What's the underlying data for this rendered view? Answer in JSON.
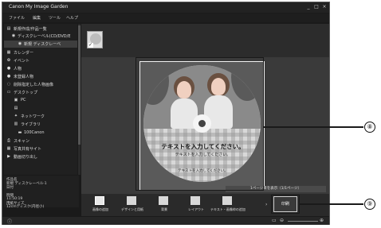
{
  "window": {
    "title": "Canon My Image Garden",
    "controls": [
      "_",
      "□",
      "×"
    ]
  },
  "menu": [
    "ファイル",
    "編集",
    "ツール",
    "ヘルプ"
  ],
  "sidebar": {
    "items": [
      {
        "label": "新規作成/作品一覧",
        "icon": "new-doc-icon",
        "glyph": "▤"
      },
      {
        "label": "ディスクレーベル(CD/DVD/E",
        "icon": "disc-icon",
        "glyph": "◉"
      },
      {
        "label": "新規 ディスクレーベ",
        "icon": "disc-icon",
        "glyph": "◉"
      },
      {
        "label": "カレンダー",
        "icon": "calendar-icon",
        "glyph": "▦"
      },
      {
        "label": "イベント",
        "icon": "event-icon",
        "glyph": "✿"
      },
      {
        "label": "人物",
        "icon": "person-icon",
        "glyph": "●"
      },
      {
        "label": "未登録人物",
        "icon": "person-icon",
        "glyph": "●"
      },
      {
        "label": "削除指定した人物画像",
        "icon": "person-delete-icon",
        "glyph": "◌"
      },
      {
        "label": "デスクトップ",
        "icon": "desktop-icon",
        "glyph": "▭"
      },
      {
        "label": "PC",
        "icon": "pc-icon",
        "glyph": "▣"
      },
      {
        "label": "",
        "icon": "drive-icon",
        "glyph": "▤"
      },
      {
        "label": "ネットワーク",
        "icon": "network-icon",
        "glyph": "✦"
      },
      {
        "label": "ライブラリ",
        "icon": "library-icon",
        "glyph": "▥"
      },
      {
        "label": "100Canon",
        "icon": "folder-icon",
        "glyph": "▬"
      },
      {
        "label": "スキャン",
        "icon": "scan-icon",
        "glyph": "⎙"
      },
      {
        "label": "写真共有サイト",
        "icon": "share-site-icon",
        "glyph": "▦"
      },
      {
        "label": "動画切り出し",
        "icon": "video-icon",
        "glyph": "▶"
      }
    ]
  },
  "info": {
    "lines": [
      "作品名",
      "新規 ディスクレーベル-1",
      "日付",
      "",
      "時間",
      "11:50:19",
      "用紙サイズ",
      "12cmディスク(内径小)"
    ]
  },
  "disc": {
    "main_text": "テキストを入力してください。",
    "sub_text": "テキストを入力してください。",
    "small_text": "テキストを入力してください。"
  },
  "page_nav": "1ページ目を表示（1/1ページ）",
  "toolbar": {
    "tools": [
      {
        "label": "画像の追加",
        "icon": "add-image-icon"
      },
      {
        "label": "デザインと用紙",
        "icon": "design-paper-icon"
      },
      {
        "label": "背景",
        "icon": "background-icon"
      },
      {
        "label": "レイアウト",
        "icon": "layout-icon"
      },
      {
        "label": "テキスト・画像枠の追加",
        "icon": "add-text-frame-icon"
      }
    ],
    "print_label": "印刷"
  },
  "callouts": [
    "⑧",
    "⑨"
  ]
}
